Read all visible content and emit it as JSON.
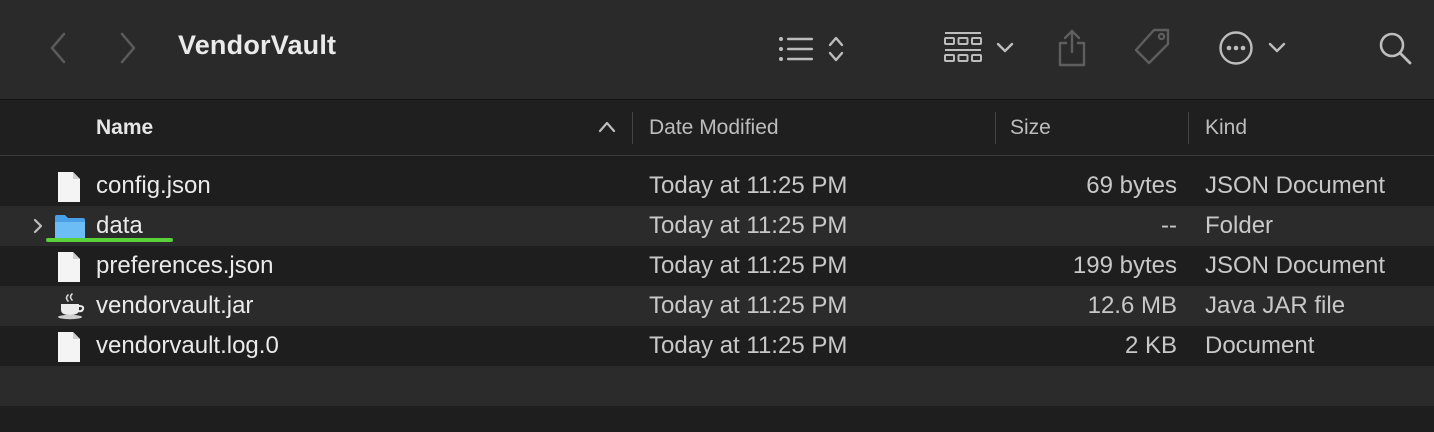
{
  "window": {
    "title": "VendorVault"
  },
  "toolbar": {
    "icons": [
      "back-icon",
      "forward-icon",
      "list-view-icon",
      "sort-arrows-icon",
      "group-grid-icon",
      "chevron-down-icon",
      "share-icon",
      "tag-icon",
      "more-icon",
      "search-icon"
    ]
  },
  "columns": {
    "name": "Name",
    "date": "Date Modified",
    "size": "Size",
    "kind": "Kind"
  },
  "files": [
    {
      "name": "config.json",
      "date": "Today at 11:25 PM",
      "size": "69 bytes",
      "kind": "JSON Document",
      "icon": "document-icon"
    },
    {
      "name": "data",
      "date": "Today at 11:25 PM",
      "size": "--",
      "kind": "Folder",
      "icon": "folder-icon"
    },
    {
      "name": "preferences.json",
      "date": "Today at 11:25 PM",
      "size": "199 bytes",
      "kind": "JSON Document",
      "icon": "document-icon"
    },
    {
      "name": "vendorvault.jar",
      "date": "Today at 11:25 PM",
      "size": "12.6 MB",
      "kind": "Java JAR file",
      "icon": "java-cup-icon"
    },
    {
      "name": "vendorvault.log.0",
      "date": "Today at 11:25 PM",
      "size": "2 KB",
      "kind": "Document",
      "icon": "document-icon"
    }
  ],
  "colors": {
    "folder": "#5ab0f0",
    "highlight_underline": "#5ad13a"
  }
}
